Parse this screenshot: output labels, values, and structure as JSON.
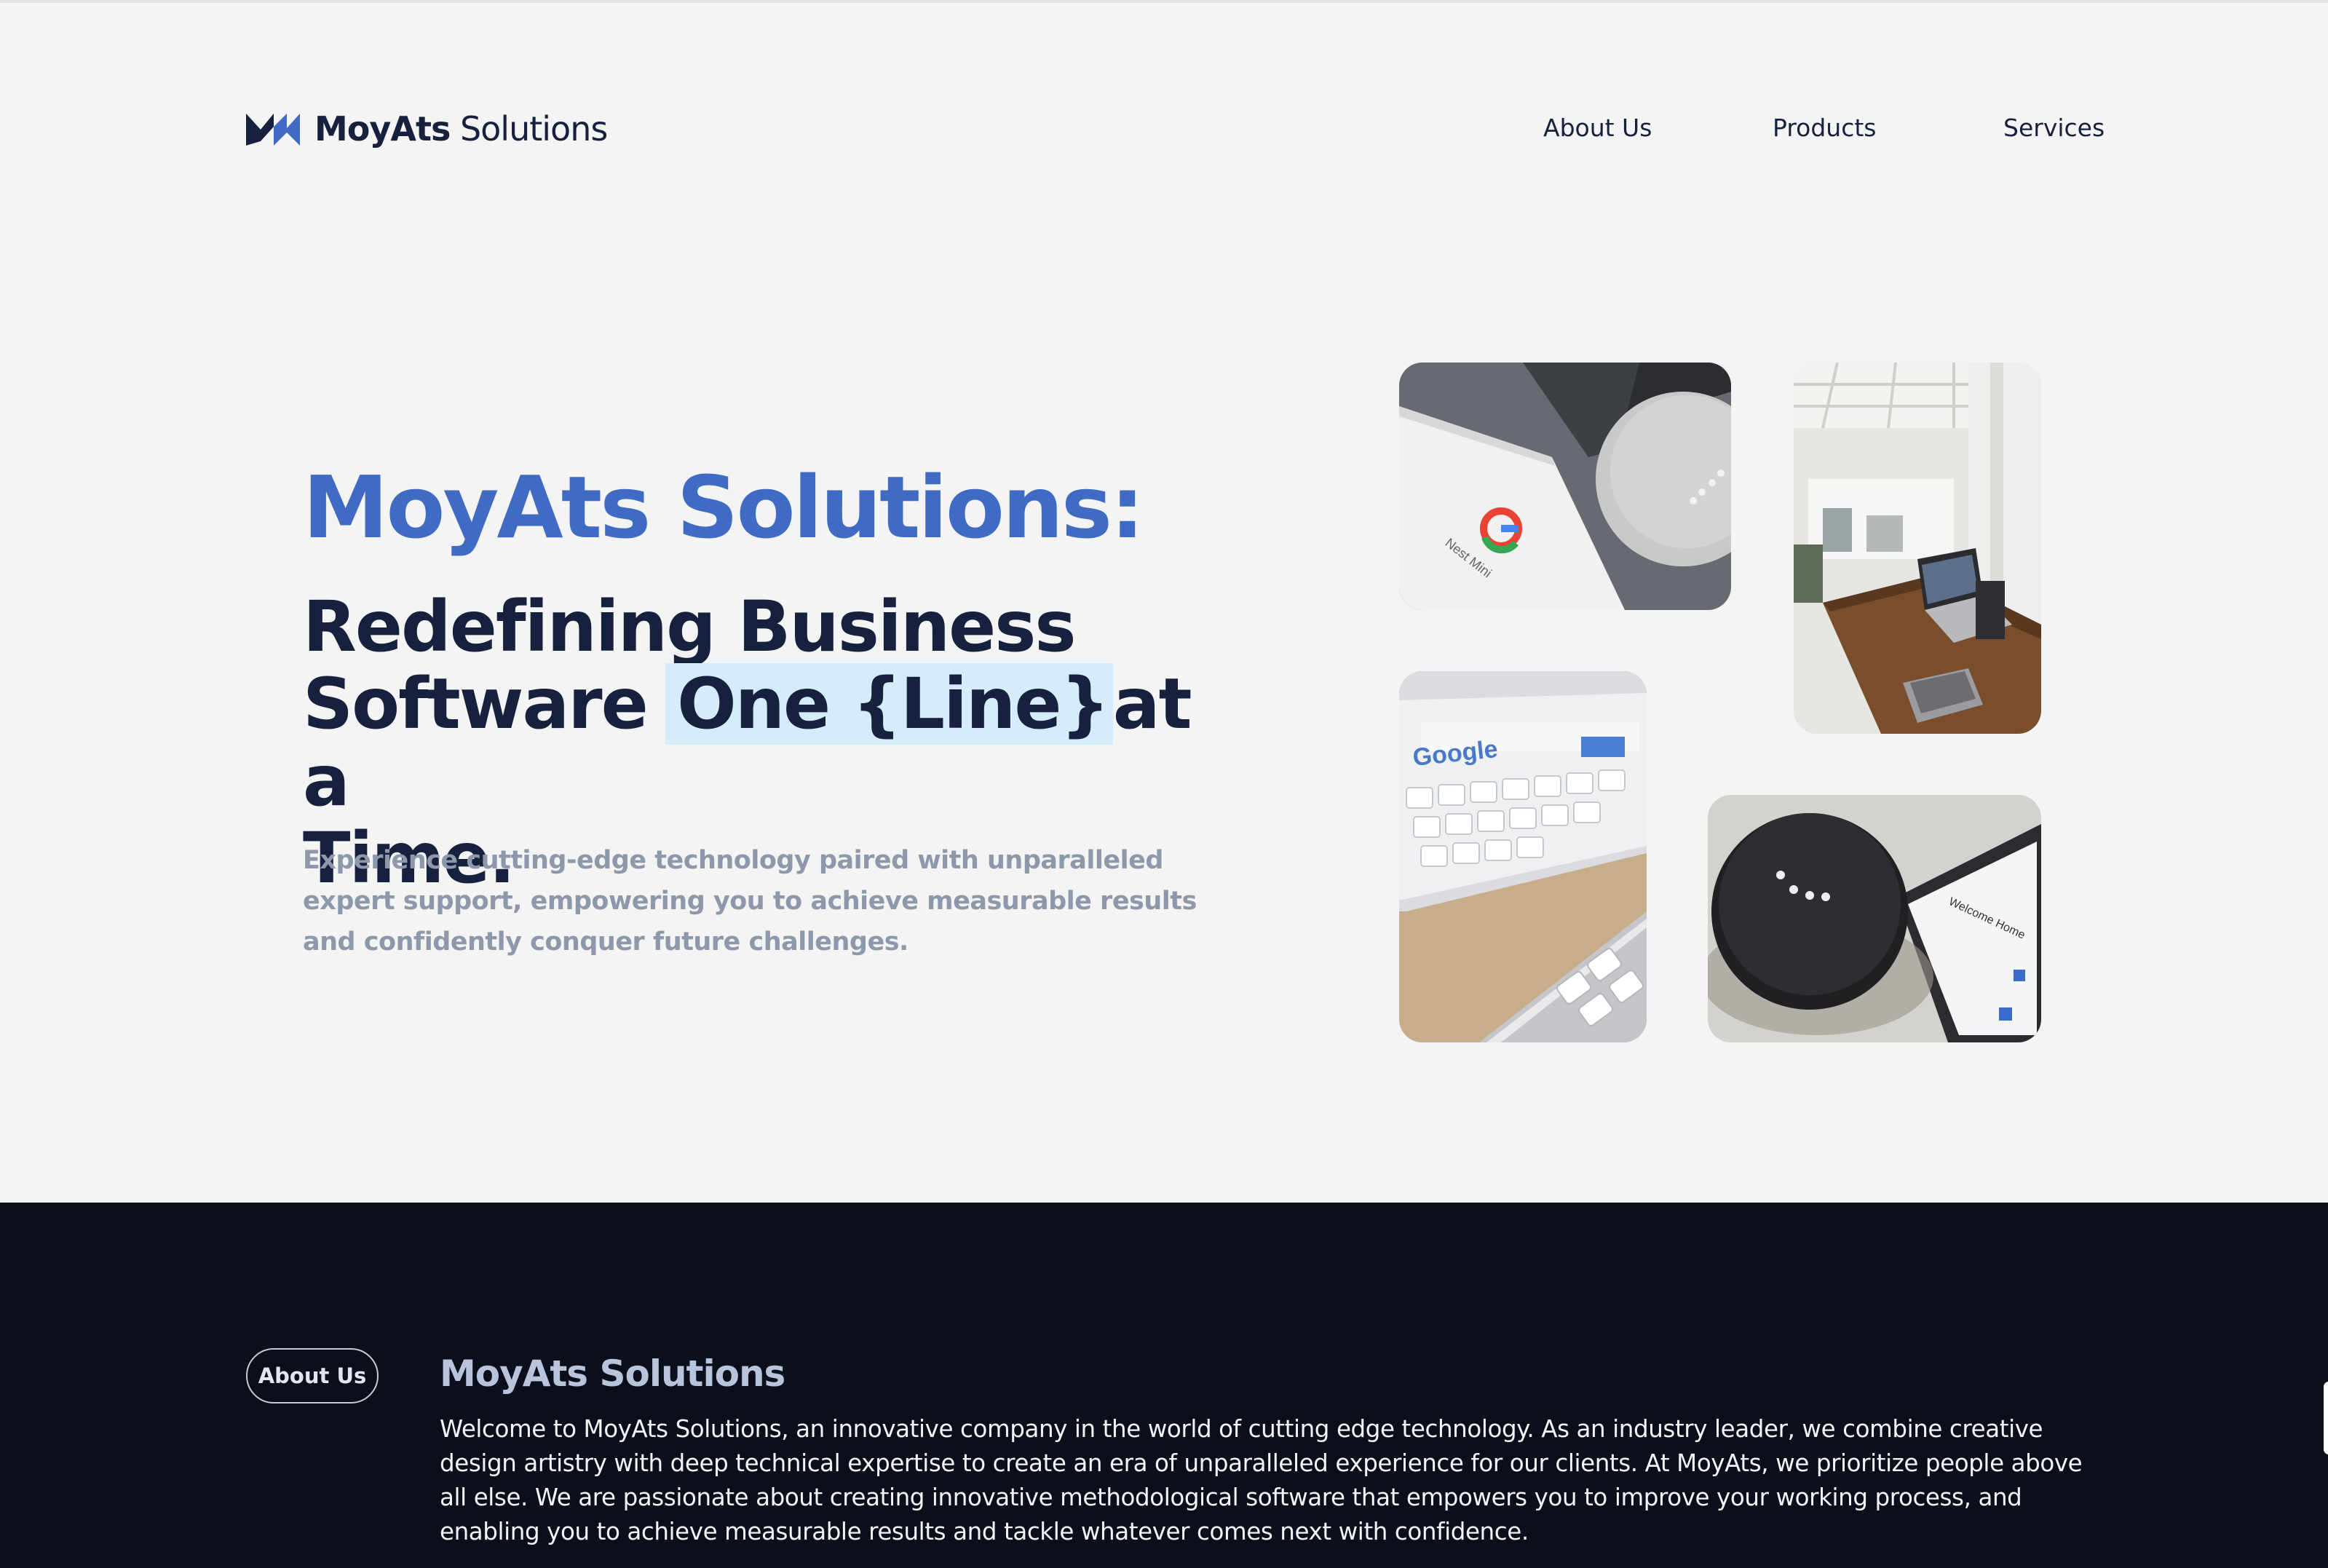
{
  "header": {
    "logo_text_bold": "MoyAts",
    "logo_text_rest": " Solutions",
    "nav": [
      "About Us",
      "Products",
      "Services"
    ]
  },
  "hero": {
    "brand": "MoyAts Solutions:",
    "title_line1": "Redefining Business",
    "title_software": "Software ",
    "title_highlight": "One {Line}",
    "title_after": "at a",
    "title_line3": "Time.",
    "subtitle": "Experience cutting-edge technology paired with unparalleled expert support, empowering you to achieve measurable results and confidently conquer future challenges.",
    "images": [
      "google-nest-mini-photo",
      "office-workspace-photo",
      "tablet-keyboard-photo",
      "smart-speaker-phone-photo"
    ],
    "tile_text_nest": "Nest Mini",
    "tile_text_google": "Google",
    "tile_text_phone": "Welcome Home"
  },
  "about": {
    "pill_label": "About Us",
    "title": "MoyAts Solutions",
    "body": "Welcome to MoyAts Solutions, an innovative company in the world of cutting edge technology. As an industry leader, we combine creative design artistry with deep technical expertise to create an era of unparalleled experience for our clients. At MoyAts, we prioritize people above all else. We are passionate about creating innovative methodological software that empowers you to improve your working process, and enabling you to achieve measurable results and tackle whatever comes next with confidence."
  },
  "colors": {
    "accent": "#3f6bc4",
    "navy": "#16213d",
    "highlight": "#d5ecfb",
    "dark_bg": "#0a0f1b",
    "page_bg": "#f4f4f4"
  }
}
